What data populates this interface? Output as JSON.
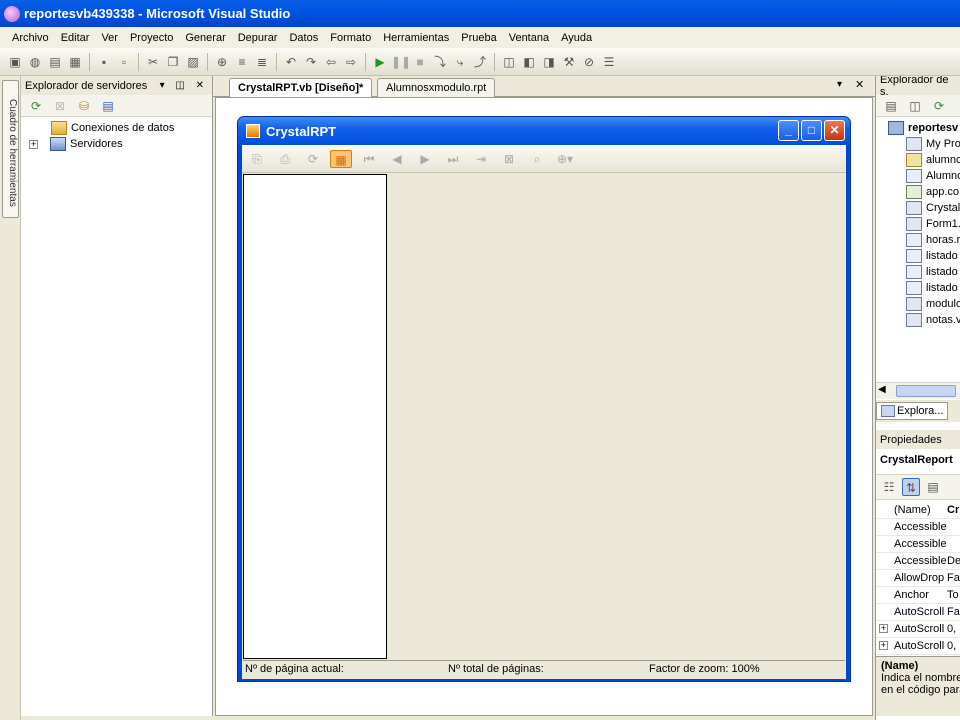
{
  "window": {
    "title": "reportesvb439338 - Microsoft Visual Studio"
  },
  "menu": [
    "Archivo",
    "Editar",
    "Ver",
    "Proyecto",
    "Generar",
    "Depurar",
    "Datos",
    "Formato",
    "Herramientas",
    "Prueba",
    "Ventana",
    "Ayuda"
  ],
  "left_strip": {
    "label": "Cuadro de herramientas"
  },
  "server_explorer": {
    "title": "Explorador de servidores",
    "items": [
      "Conexiones de datos",
      "Servidores"
    ]
  },
  "doc_tabs": [
    "CrystalRPT.vb [Diseño]*",
    "Alumnosxmodulo.rpt"
  ],
  "form": {
    "title": "CrystalRPT",
    "status": {
      "current_page": "Nº de página actual:",
      "total_pages": "Nº total de páginas:",
      "zoom": "Factor de zoom: 100%"
    }
  },
  "solution_explorer": {
    "title": "Explorador de s.",
    "items": [
      "reportesv",
      "My Pro",
      "alumno",
      "Alumno",
      "app.co",
      "Crystal",
      "Form1.",
      "horas.r",
      "listado",
      "listado",
      "listado",
      "modulo",
      "notas.v"
    ],
    "tab_label": "Explora..."
  },
  "properties": {
    "title": "Propiedades",
    "object": "CrystalReport",
    "rows": [
      {
        "name": "(Name)",
        "value": "Cr"
      },
      {
        "name": "Accessible",
        "value": ""
      },
      {
        "name": "Accessible",
        "value": ""
      },
      {
        "name": "Accessible",
        "value": "De"
      },
      {
        "name": "AllowDrop",
        "value": "Fa"
      },
      {
        "name": "Anchor",
        "value": "To"
      },
      {
        "name": "AutoScroll",
        "value": "Fa"
      },
      {
        "name": "AutoScroll",
        "value": "0,"
      },
      {
        "name": "AutoScroll",
        "value": "0,"
      }
    ],
    "desc_title": "(Name)",
    "desc_text": [
      "Indica el nombre",
      "en el código para"
    ]
  }
}
